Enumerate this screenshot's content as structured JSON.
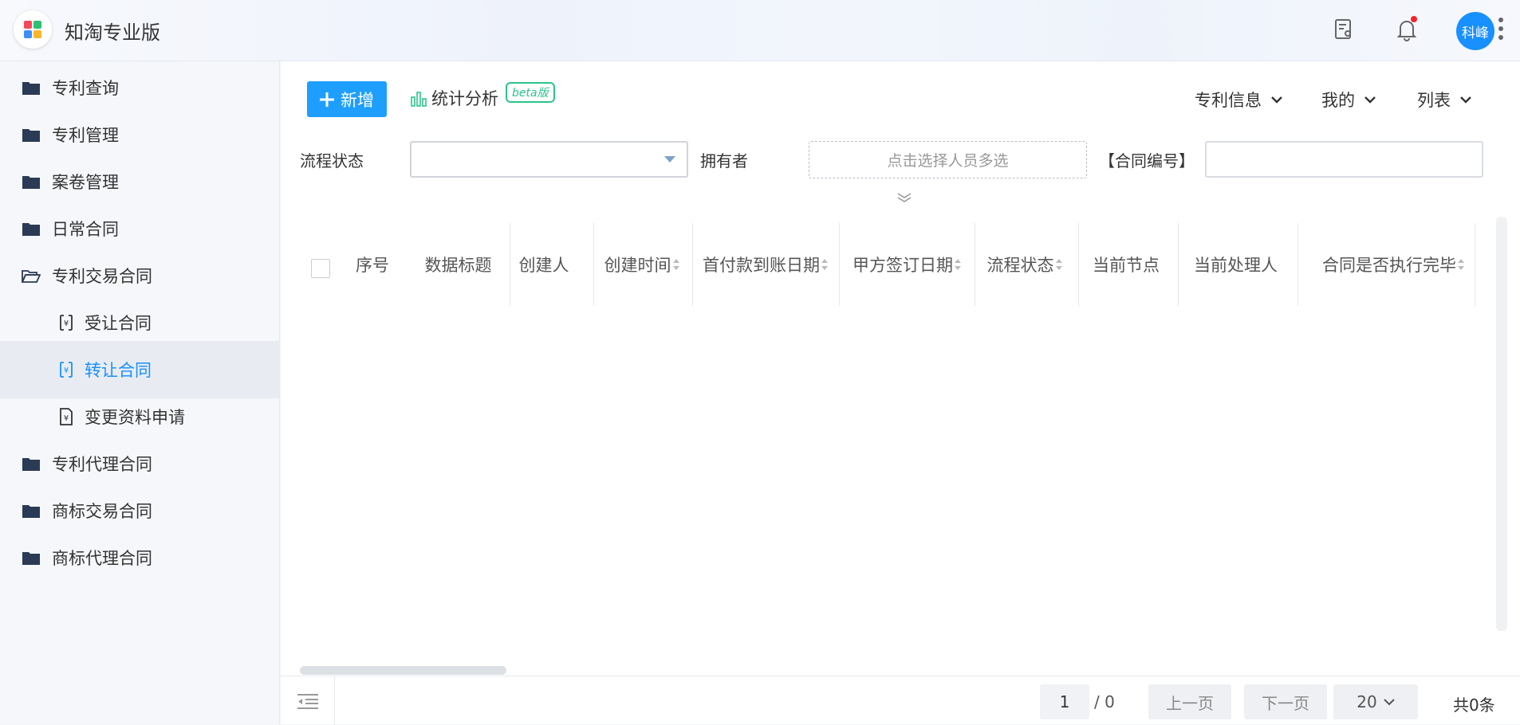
{
  "app": {
    "title": "知淘专业版"
  },
  "header": {
    "avatar_text": "科峰",
    "icons": [
      "document-user-icon",
      "bell-icon",
      "more-vertical-icon"
    ],
    "notification_dot_color": "#f5222d"
  },
  "sidebar": {
    "items": [
      {
        "label": "专利查询",
        "icon": "folder-icon"
      },
      {
        "label": "专利管理",
        "icon": "folder-icon"
      },
      {
        "label": "案卷管理",
        "icon": "folder-icon"
      },
      {
        "label": "日常合同",
        "icon": "folder-icon"
      },
      {
        "label": "专利交易合同",
        "icon": "folder-open-icon",
        "expanded": true
      },
      {
        "label": "受让合同",
        "icon": "contract-yen-icon"
      },
      {
        "label": "转让合同",
        "icon": "contract-yen-icon",
        "active": true
      },
      {
        "label": "变更资料申请",
        "icon": "document-yen-icon"
      },
      {
        "label": "专利代理合同",
        "icon": "folder-icon"
      },
      {
        "label": "商标交易合同",
        "icon": "folder-icon"
      },
      {
        "label": "商标代理合同",
        "icon": "folder-icon"
      }
    ]
  },
  "toolbar": {
    "add_label": "新增",
    "stat_label": "统计分析",
    "beta_label": "beta版",
    "dropdowns": [
      "专利信息",
      "我的",
      "列表"
    ]
  },
  "filters": {
    "status_label": "流程状态",
    "owner_label": "拥有者",
    "owner_placeholder": "点击选择人员多选",
    "contract_no_label": "【合同编号】"
  },
  "table": {
    "columns": [
      "序号",
      "数据标题",
      "创建人",
      "创建时间",
      "首付款到账日期",
      "甲方签订日期",
      "流程状态",
      "当前节点",
      "当前处理人",
      "合同是否执行完毕"
    ],
    "sortable": [
      false,
      false,
      false,
      true,
      true,
      true,
      true,
      false,
      false,
      true
    ],
    "rows": []
  },
  "pagination": {
    "current_page": "1",
    "total_pages": "/ 0",
    "prev_label": "上一页",
    "next_label": "下一页",
    "page_size": "20",
    "total_count": "共0条"
  },
  "colors": {
    "primary": "#1e9fff",
    "active_text": "#1890ff",
    "beta": "#2bc48a"
  }
}
